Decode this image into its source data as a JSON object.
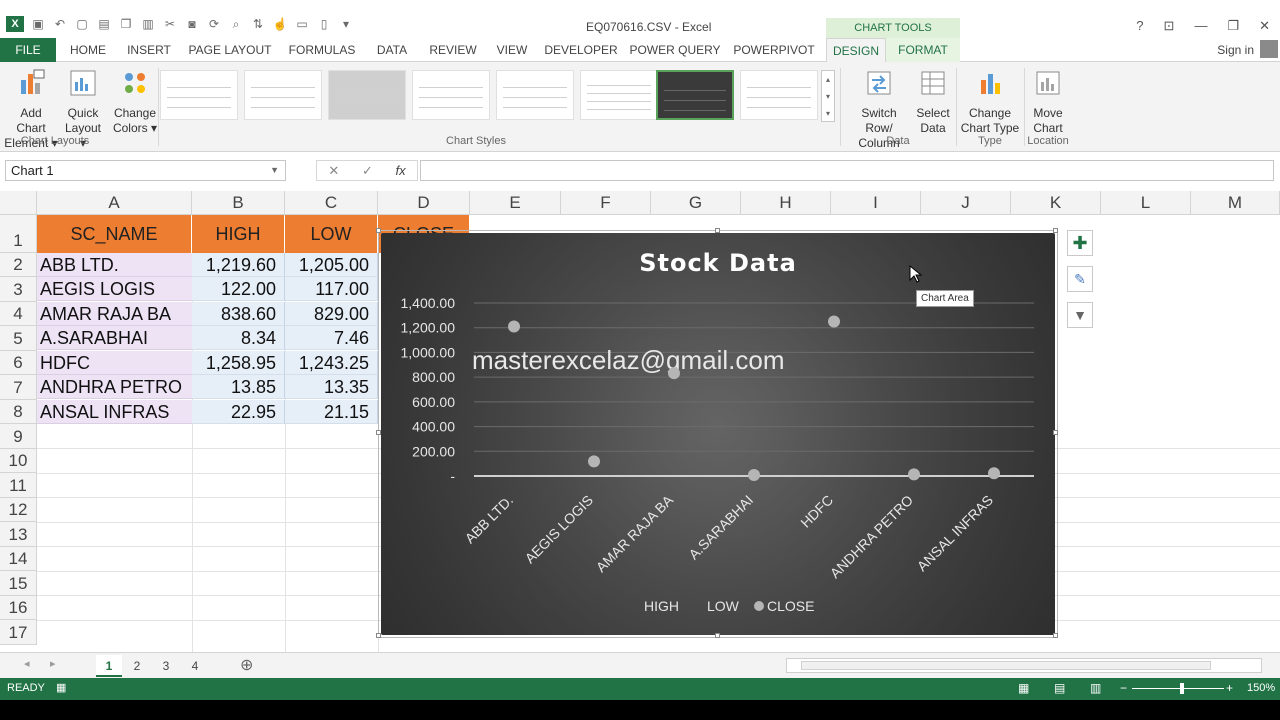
{
  "window": {
    "title": "EQ070616.CSV - Excel",
    "context_tab_group": "CHART TOOLS",
    "sign_in": "Sign in",
    "help": "?",
    "controls": [
      "⊡",
      "—",
      "❐",
      "✕"
    ]
  },
  "tabs": [
    "FILE",
    "HOME",
    "INSERT",
    "PAGE LAYOUT",
    "FORMULAS",
    "DATA",
    "REVIEW",
    "VIEW",
    "DEVELOPER",
    "POWER QUERY",
    "POWERPIVOT",
    "DESIGN",
    "FORMAT"
  ],
  "ribbon": {
    "add_chart_element": [
      "Add Chart",
      "Element ▾"
    ],
    "quick_layout": [
      "Quick",
      "Layout ▾"
    ],
    "change_colors": [
      "Change",
      "Colors ▾"
    ],
    "chart_layouts_label": "Chart Layouts",
    "chart_styles_label": "Chart Styles",
    "switch_row_column": [
      "Switch Row/",
      "Column"
    ],
    "select_data": [
      "Select",
      "Data"
    ],
    "data_label": "Data",
    "change_chart_type": [
      "Change",
      "Chart Type"
    ],
    "type_label": "Type",
    "move_chart": [
      "Move",
      "Chart"
    ],
    "location_label": "Location",
    "accent": "#217346"
  },
  "formula_bar": {
    "name_box": "Chart 1",
    "cancel": "✕",
    "enter": "✓",
    "fx": "fx",
    "value": ""
  },
  "sheet": {
    "columns": [
      "A",
      "B",
      "C",
      "D",
      "E",
      "F",
      "G",
      "H",
      "I",
      "J",
      "K",
      "L",
      "M"
    ],
    "rows": [
      "1",
      "2",
      "3",
      "4",
      "5",
      "6",
      "7",
      "8",
      "9",
      "10",
      "11",
      "12",
      "13",
      "14",
      "15",
      "16",
      "17"
    ],
    "header": [
      "SC_NAME",
      "HIGH",
      "LOW",
      "CLOSE"
    ],
    "data": [
      [
        "ABB LTD.",
        "1,219.60",
        "1,205.00"
      ],
      [
        "AEGIS LOGIS",
        "122.00",
        "117.00"
      ],
      [
        "AMAR RAJA BA",
        "838.60",
        "829.00"
      ],
      [
        "A.SARABHAI",
        "8.34",
        "7.46"
      ],
      [
        "HDFC",
        "1,258.95",
        "1,243.25"
      ],
      [
        "ANDHRA PETRO",
        "13.85",
        "13.35"
      ],
      [
        "ANSAL INFRAS",
        "22.95",
        "21.15"
      ]
    ],
    "header_color": "#ed7d31"
  },
  "chart_data": {
    "type": "scatter",
    "title": "Stock Data",
    "watermark": "masterexcelaz@gmail.com",
    "categories": [
      "ABB LTD.",
      "AEGIS LOGIS",
      "AMAR RAJA BA",
      "A.SARABHAI",
      "HDFC",
      "ANDHRA PETRO",
      "ANSAL INFRAS"
    ],
    "ytick_labels": [
      "-",
      "200.00",
      "400.00",
      "600.00",
      "800.00",
      "1,200.00",
      "1,400.00",
      "1,000.00"
    ],
    "ylim": [
      0,
      1400
    ],
    "series": [
      {
        "name": "CLOSE",
        "values": [
          1210,
          118,
          832,
          7.8,
          1250,
          13.5,
          22
        ],
        "marker": "circle",
        "color": "#b5b5b5"
      }
    ],
    "legend": [
      "HIGH",
      "LOW",
      "CLOSE"
    ],
    "legend_position": "bottom",
    "grid": true,
    "background": "#3c3c3c",
    "tooltip": "Chart Area"
  },
  "sheets": {
    "tabs": [
      "1",
      "2",
      "3",
      "4"
    ],
    "active": "1",
    "add": "⊕"
  },
  "status": {
    "mode": "READY",
    "zoom": "150%"
  }
}
